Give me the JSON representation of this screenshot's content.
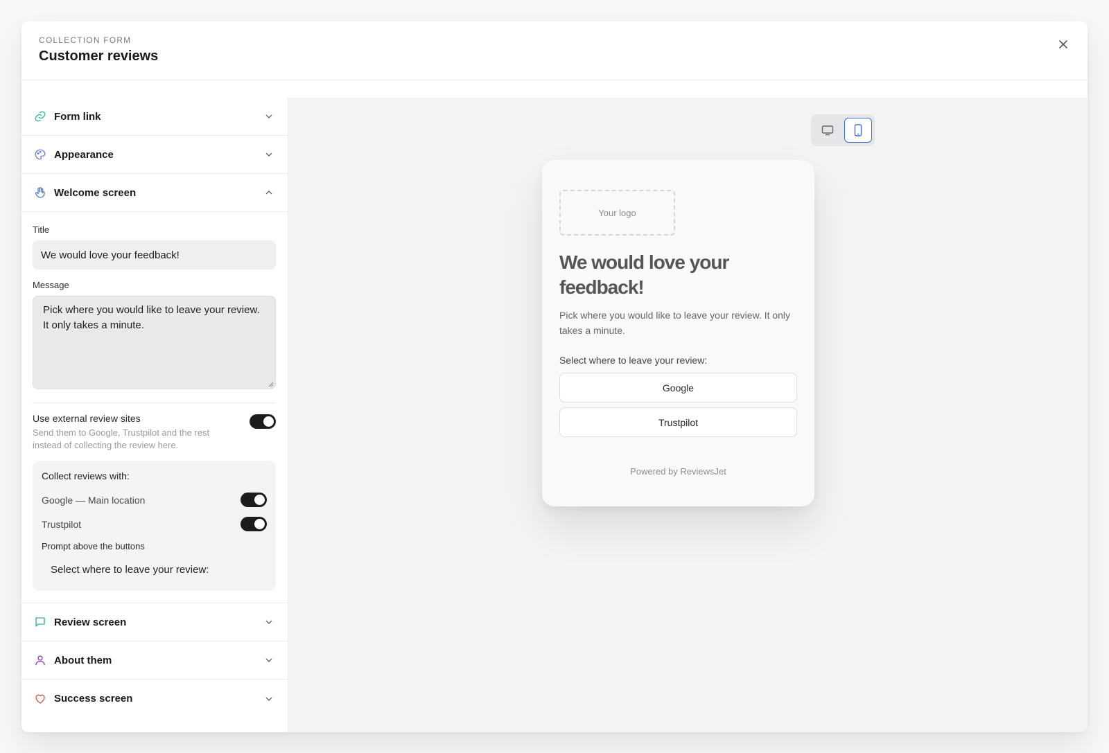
{
  "header": {
    "eyebrow": "COLLECTION FORM",
    "title": "Customer reviews"
  },
  "sidebar": {
    "sections_top": [
      {
        "label": "Form link",
        "icon": "link-icon",
        "color": "#2bb39b"
      },
      {
        "label": "Appearance",
        "icon": "palette-icon",
        "color": "#6a7dd6"
      },
      {
        "label": "Welcome screen",
        "icon": "hand-icon",
        "color": "#4a78d6"
      }
    ],
    "welcome": {
      "title_label": "Title",
      "title_value": "We would love your feedback!",
      "message_label": "Message",
      "message_value": "Pick where you would like to leave your review. It only takes a minute.",
      "external_label": "Use external review sites",
      "external_desc": "Send them to Google, Trustpilot and the rest instead of collecting the review here.",
      "external_enabled": true,
      "collect_title": "Collect reviews with:",
      "sites": [
        {
          "label": "Google — Main location",
          "enabled": true
        },
        {
          "label": "Trustpilot",
          "enabled": true
        }
      ],
      "prompt_label": "Prompt above the buttons",
      "prompt_value": "Select where to leave your review:"
    },
    "sections_bottom": [
      {
        "label": "Review screen",
        "icon": "chat-bubble-icon",
        "color": "#2bb39b"
      },
      {
        "label": "About them",
        "icon": "person-icon",
        "color": "#8a3bb0"
      },
      {
        "label": "Success screen",
        "icon": "heart-icon",
        "color": "#d9534f"
      }
    ]
  },
  "preview": {
    "active_device": "mobile",
    "logo_placeholder": "Your logo",
    "title": "We would love your feedback!",
    "message": "Pick where you would like to leave your review. It only takes a minute.",
    "prompt": "Select where to leave your review:",
    "buttons": [
      "Google",
      "Trustpilot"
    ],
    "powered_by": "Powered by ReviewsJet"
  }
}
